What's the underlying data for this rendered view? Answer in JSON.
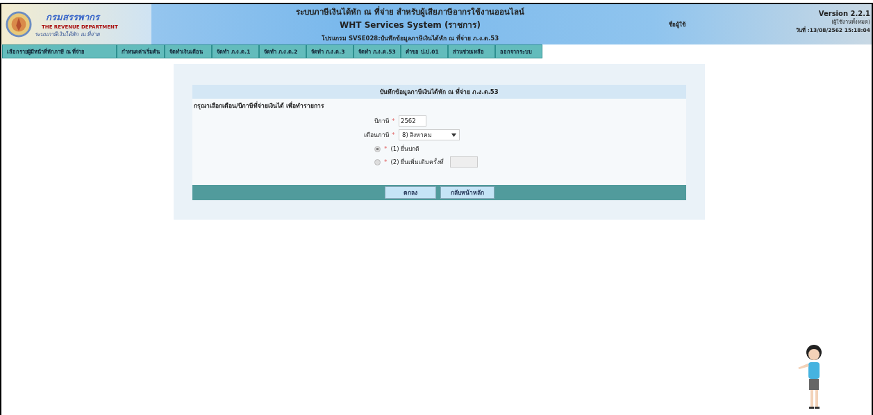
{
  "header": {
    "logo": {
      "name_th": "กรมสรรพากร",
      "name_en": "THE REVENUE DEPARTMENT",
      "system": "ระบบภาษีเงินได้หัก ณ ที่จ่าย"
    },
    "title": "ระบบภาษีเงินได้หัก ณ ที่จ่าย สำหรับผู้เสียภาษีอากรใช้งานออนไลน์",
    "subtitle": "WHT Services System  (ราชการ)",
    "program": "โปรแกรม SVSE028:บันทึกข้อมูลภาษีเงินได้หัก ณ ที่จ่าย ภ.ง.ด.53",
    "user_label": "ชื่อผู้ใช้",
    "version": "Version 2.2.1",
    "user_scope": "(ผู้ใช้งานทั้งหมด)",
    "date": "วันที่ :13/08/2562 15:18:04"
  },
  "nav": [
    {
      "label": "เลือกรายผู้มีหน้าที่หักภาษี ณ ที่จ่าย"
    },
    {
      "label": "กำหนดค่าเริ่มต้น"
    },
    {
      "label": "จัดทำเงินเดือน"
    },
    {
      "label": "จัดทำ ภ.ง.ด.1"
    },
    {
      "label": "จัดทำ ภ.ง.ด.2"
    },
    {
      "label": "จัดทำ ภ.ง.ด.3"
    },
    {
      "label": "จัดทำ ภ.ง.ด.53"
    },
    {
      "label": "คำขอ ป.ป.01"
    },
    {
      "label": "ส่วนช่วยเหลือ"
    },
    {
      "label": "ออกจากระบบ"
    }
  ],
  "form": {
    "title": "บันทึกข้อมูลภาษีเงินได้หัก ณ ที่จ่าย ภ.ง.ด.53",
    "instruction": "กรุณาเลือกเดือน/ปีภาษีที่จ่ายเงินได้ เพื่อทำรายการ",
    "fields": [
      {
        "kind": "input",
        "label": "ปีภาษี",
        "mark": "*",
        "value": "2562"
      },
      {
        "kind": "select",
        "label": "เดือนภาษี",
        "mark": "*",
        "value": "8) สิงหาคม"
      }
    ],
    "options": [
      {
        "label": "(1) ยื่นปกติ",
        "mark": "*",
        "selected": true,
        "has_field": false
      },
      {
        "label": "(2) ยื่นเพิ่มเติมครั้งที่",
        "mark": "*",
        "selected": false,
        "has_field": true
      }
    ],
    "buttons": [
      "ตกลง",
      "กลับหน้าหลัก"
    ]
  }
}
